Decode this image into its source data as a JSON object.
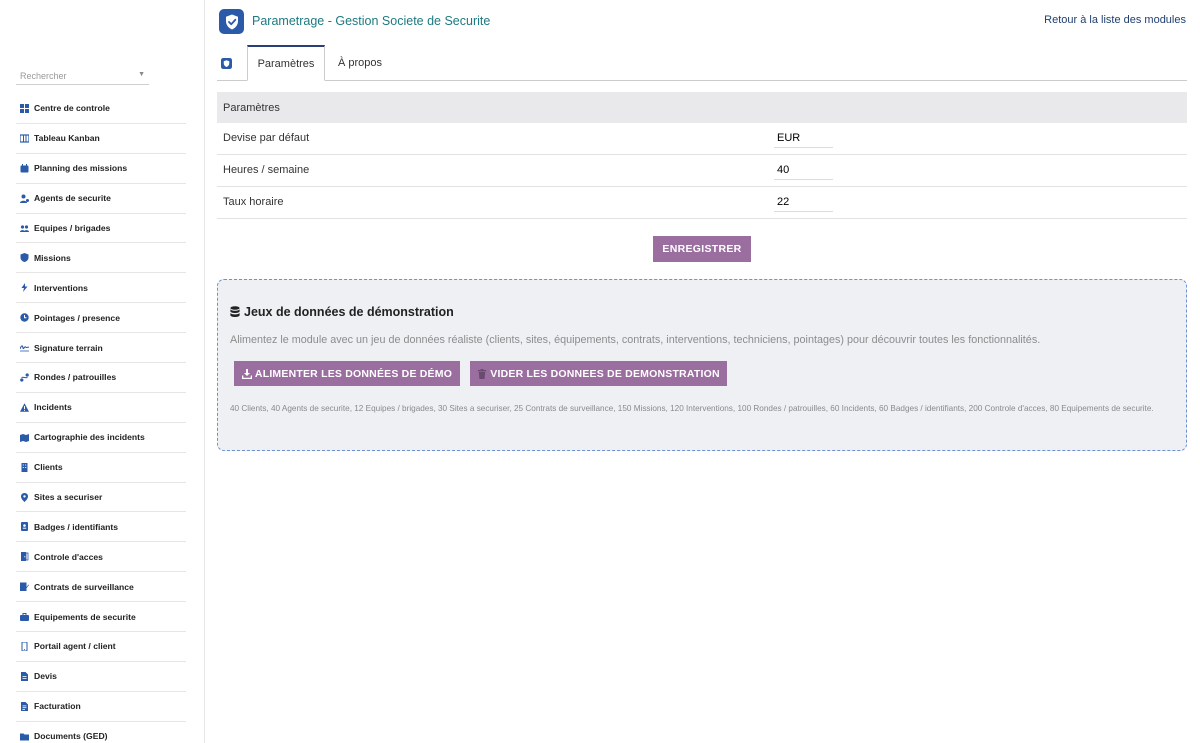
{
  "header": {
    "title": "Parametrage - Gestion Societe de Securite",
    "back_link": "Retour à la liste des modules",
    "logo_icon": "shield-check-icon"
  },
  "sidebar": {
    "search_placeholder": "Rechercher",
    "items": [
      {
        "label": "Centre de controle",
        "icon": "grid-icon"
      },
      {
        "label": "Tableau Kanban",
        "icon": "kanban-icon"
      },
      {
        "label": "Planning des missions",
        "icon": "calendar-icon"
      },
      {
        "label": "Agents de securite",
        "icon": "user-cog-icon"
      },
      {
        "label": "Equipes / brigades",
        "icon": "users-icon"
      },
      {
        "label": "Missions",
        "icon": "shield-icon"
      },
      {
        "label": "Interventions",
        "icon": "bolt-icon"
      },
      {
        "label": "Pointages / presence",
        "icon": "clock-icon"
      },
      {
        "label": "Signature terrain",
        "icon": "signature-icon"
      },
      {
        "label": "Rondes / patrouilles",
        "icon": "route-icon"
      },
      {
        "label": "Incidents",
        "icon": "warning-icon"
      },
      {
        "label": "Cartographie des incidents",
        "icon": "map-icon"
      },
      {
        "label": "Clients",
        "icon": "building-icon"
      },
      {
        "label": "Sites a securiser",
        "icon": "map-pin-icon"
      },
      {
        "label": "Badges / identifiants",
        "icon": "id-badge-icon"
      },
      {
        "label": "Controle d'acces",
        "icon": "door-icon"
      },
      {
        "label": "Contrats de surveillance",
        "icon": "contract-icon"
      },
      {
        "label": "Equipements de securite",
        "icon": "toolbox-icon"
      },
      {
        "label": "Portail agent / client",
        "icon": "mobile-icon"
      },
      {
        "label": "Devis",
        "icon": "file-icon"
      },
      {
        "label": "Facturation",
        "icon": "invoice-icon"
      },
      {
        "label": "Documents (GED)",
        "icon": "folder-icon"
      }
    ]
  },
  "tabs": [
    {
      "label": "Paramètres",
      "active": true
    },
    {
      "label": "À propos",
      "active": false
    }
  ],
  "params": {
    "header": "Paramètres",
    "rows": [
      {
        "label": "Devise par défaut",
        "value": "EUR"
      },
      {
        "label": "Heures / semaine",
        "value": "40"
      },
      {
        "label": "Taux horaire",
        "value": "22"
      }
    ],
    "save_label": "ENREGISTRER"
  },
  "demo": {
    "title": "Jeux de données de démonstration",
    "description": "Alimentez le module avec un jeu de données réaliste (clients, sites, équipements, contrats, interventions, techniciens, pointages) pour découvrir toutes les fonctionnalités.",
    "feed_label": "ALIMENTER LES DONNÉES DE DÉMO",
    "clear_label": "VIDER LES DONNEES DE DEMONSTRATION",
    "summary": "40 Clients, 40 Agents de securite, 12 Equipes / brigades, 30 Sites a securiser, 25 Contrats de surveillance, 150 Missions, 120 Interventions, 100 Rondes / patrouilles, 60 Incidents, 60 Badges / identifiants, 200 Controle d'acces, 80 Equipements de securite."
  },
  "colors": {
    "accent_purple": "#9b6ea0",
    "icon_blue": "#2b5aa8",
    "title_teal": "#1e7a80",
    "demo_border": "#6f8fd4"
  }
}
